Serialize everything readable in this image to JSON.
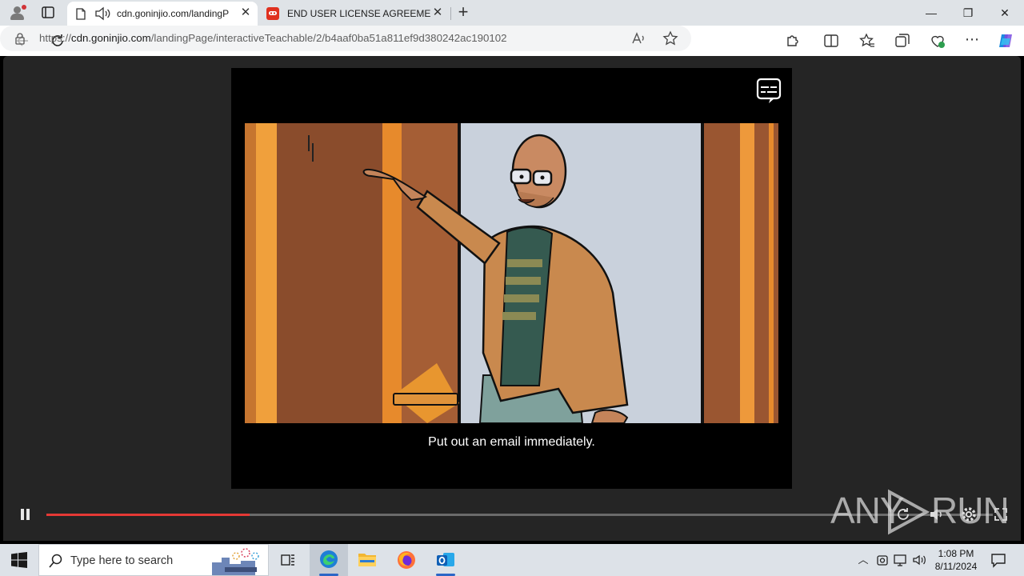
{
  "browser": {
    "tabs": [
      {
        "title": "cdn.goninjio.com/landingP",
        "active": true,
        "audio": true
      },
      {
        "title": "END USER LICENSE AGREEMENT",
        "active": false
      }
    ],
    "new_tab_label": "+",
    "close_glyph": "✕",
    "url_scheme": "https://",
    "url_host": "cdn.goninjio.com",
    "url_path": "/landingPage/interactiveTeachable/2/b4aaf0ba51a811ef9d380242ac190102",
    "window_controls": {
      "minimize": "—",
      "restore": "❐",
      "close": "✕"
    }
  },
  "player": {
    "caption": "Put out an email immediately.",
    "progress": 0.215,
    "state": "playing"
  },
  "watermark": {
    "text": "ANY RUN"
  },
  "taskbar": {
    "search_placeholder": "Type here to search",
    "pinned": [
      "task-view",
      "edge",
      "file-explorer",
      "firefox",
      "outlook"
    ],
    "active_app": "edge",
    "time": "1:08 PM",
    "date": "8/11/2024"
  },
  "colors": {
    "tabstrip": "#dfe3e7",
    "page_background": "#252525",
    "progress_fill": "#e53935",
    "taskbar": "#dde2e8",
    "accent": "#0078d4"
  }
}
